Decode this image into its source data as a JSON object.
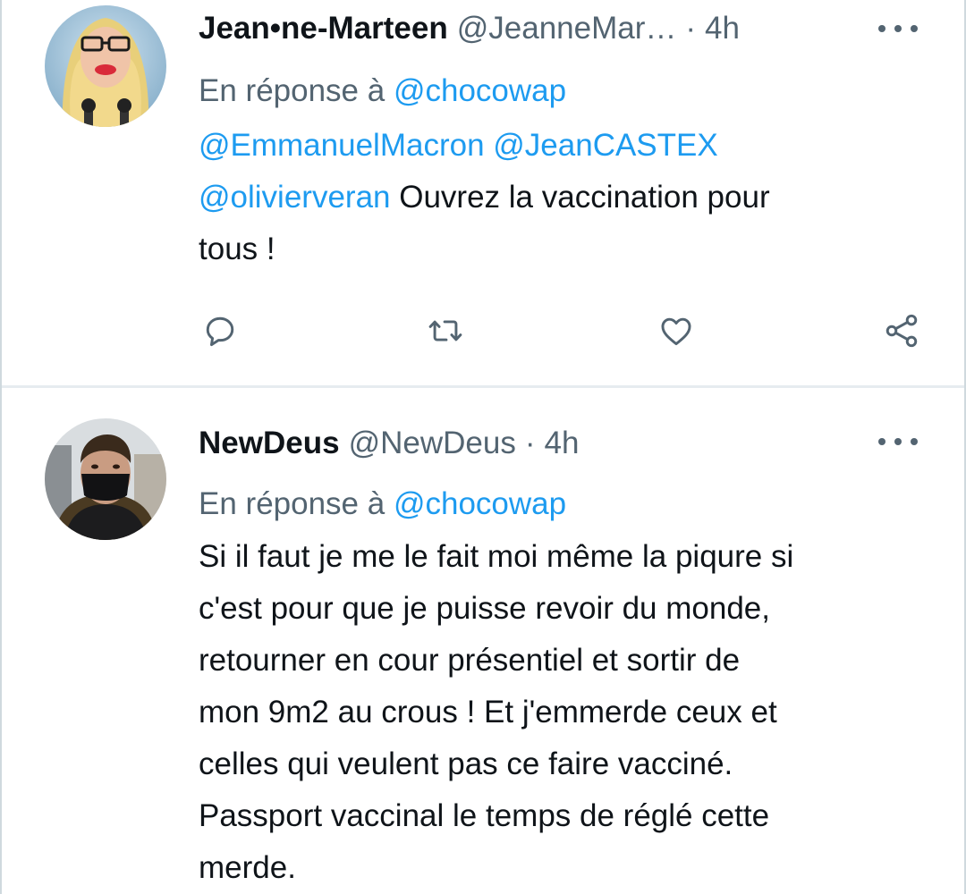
{
  "tweets": [
    {
      "display_name": "Jean•ne-Marteen",
      "handle": "@JeanneMar…",
      "separator": "·",
      "time": "4h",
      "reply_prefix": "En réponse à",
      "reply_to": "@chocowap",
      "body_lines": [
        {
          "mentions": [
            "@EmmanuelMacron",
            "@JeanCASTEX"
          ]
        },
        {
          "mention": "@olivierveran",
          "text": " Ouvrez la vaccination pour"
        },
        {
          "text": "tous !"
        }
      ],
      "avatar": "avatar-blonde-glasses",
      "actions": [
        "reply-icon",
        "retweet-icon",
        "like-icon",
        "share-icon"
      ]
    },
    {
      "display_name": "NewDeus",
      "handle": "@NewDeus",
      "separator": "·",
      "time": "4h",
      "reply_prefix": "En réponse à",
      "reply_to": "@chocowap",
      "body_lines": [
        "Si il faut je me le fait moi même la piqure si",
        "c'est pour que je puisse revoir du monde,",
        "retourner en cour présentiel et sortir de",
        "mon 9m2 au crous ! Et j'emmerde ceux et",
        "celles qui veulent pas ce faire vacciné.",
        "Passport vaccinal le temps de réglé cette",
        "merde."
      ],
      "avatar": "avatar-masked-person"
    }
  ],
  "colors": {
    "text": "#0f1419",
    "secondary": "#536471",
    "link": "#1d9bf0",
    "divider": "#e6ecf0"
  }
}
